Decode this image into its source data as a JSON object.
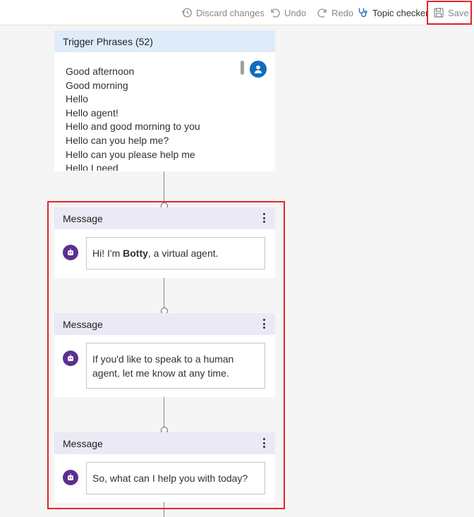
{
  "toolbar": {
    "discard_label": "Discard changes",
    "undo_label": "Undo",
    "redo_label": "Redo",
    "topic_checker_label": "Topic checker",
    "save_label": "Save"
  },
  "trigger": {
    "title": "Trigger Phrases (52)",
    "phrases": [
      "Good afternoon",
      "Good morning",
      "Hello",
      "Hello agent!",
      "Hello and good morning to you",
      "Hello can you help me?",
      "Hello can you please help me",
      "Hello I need"
    ]
  },
  "messages": [
    {
      "title": "Message",
      "pre": "Hi! I'm ",
      "bold": "Botty",
      "post": ", a virtual agent."
    },
    {
      "title": "Message",
      "text": "If you'd like to speak to a human agent, let me know at any time."
    },
    {
      "title": "Message",
      "text": "So, what can I help you with today?"
    }
  ],
  "icons": {
    "discard": "history-icon",
    "undo": "undo-icon",
    "redo": "redo-icon",
    "topic_checker": "stethoscope-icon",
    "save": "save-icon",
    "bot": "bot-icon",
    "user": "user-icon"
  },
  "colors": {
    "highlight": "#e3242b",
    "trigger_header": "#deecf9",
    "message_header": "#ebe9f5",
    "bot_avatar": "#5c2e91",
    "user_avatar": "#0f6cbd"
  }
}
